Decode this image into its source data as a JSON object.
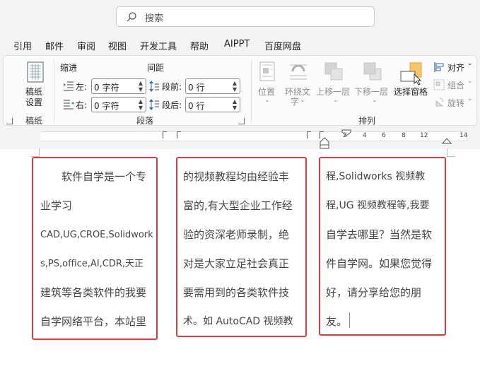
{
  "search": {
    "placeholder": "搜索"
  },
  "menu": [
    "引用",
    "邮件",
    "审阅",
    "视图",
    "开发工具",
    "帮助",
    "AIPPT",
    "百度网盘"
  ],
  "ribbon": {
    "manuscript": {
      "button_line1": "稿纸",
      "button_line2": "设置",
      "group_label": "稿纸"
    },
    "paragraph": {
      "indent_header": "缩进",
      "spacing_header": "间距",
      "left_label": "左:",
      "right_label": "右:",
      "before_label": "段前:",
      "after_label": "段后:",
      "left_value": "0 字符",
      "right_value": "0 字符",
      "before_value": "0 行",
      "after_value": "0 行",
      "group_label": "段落"
    },
    "arrange": {
      "position": "位置",
      "wrap_line1": "环绕文",
      "wrap_line2": "字",
      "bring_forward": "上移一层",
      "send_backward": "下移一层",
      "selection_pane": "选择窗格",
      "align": "对齐",
      "group": "组合",
      "rotate": "旋转",
      "group_label": "排列"
    }
  },
  "ruler_ticks": [
    "2",
    "4",
    "6",
    "8",
    "12",
    "14"
  ],
  "columns": [
    [
      "　　软件自学是一个专",
      "业学习",
      "CAD,UG,CROE,Solidwork",
      "s,PS,office,AI,CDR,天正",
      "建筑等各类软件的我要",
      "自学网络平台，本站里"
    ],
    [
      "的视频教程均由经验丰",
      "富的,有大型企业工作经",
      "验的资深老师录制，绝",
      "对是大家立足社会真正",
      "要需用到的各类软件技",
      "术。如 AutoCAD 视频教"
    ],
    [
      "程,Solidworks 视频教",
      "程,UG 视频教程等,我要",
      "自学去哪里？当然是软",
      "件自学网。如果您觉得",
      "好，请分享给您的朋",
      "友。"
    ]
  ],
  "colors": {
    "highlight_border": "#e03b3b"
  }
}
